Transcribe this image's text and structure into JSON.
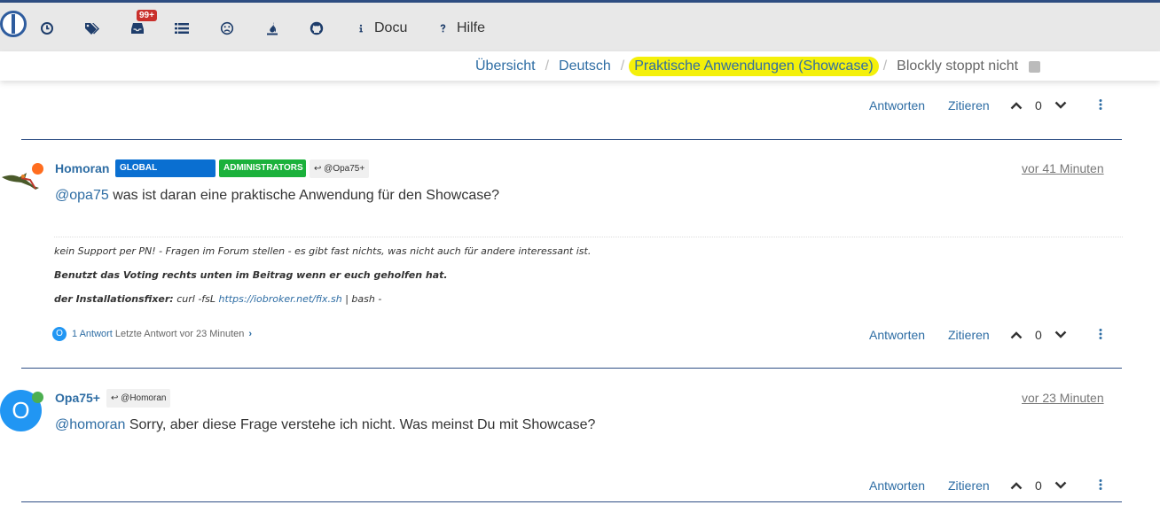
{
  "nav": {
    "unread_badge": "99+",
    "docu_label": "Docu",
    "help_label": "Hilfe"
  },
  "breadcrumb": {
    "items": [
      "Übersicht",
      "Deutsch",
      "Praktische Anwendungen (Showcase)",
      "Blockly stoppt nicht"
    ]
  },
  "actions": {
    "reply_label": "Antworten",
    "quote_label": "Zitieren"
  },
  "posts": [
    {
      "votes": "0"
    },
    {
      "username": "Homoran",
      "groups": [
        "GLOBAL MODERATOR",
        "ADMINISTRATORS"
      ],
      "group_colors": [
        "#0a6fd1",
        "#1bb13b"
      ],
      "reply_to": "@Opa75+",
      "timestamp": "vor 41 Minuten",
      "mention": "@opa75",
      "text": "was ist daran eine praktische Anwendung für den Showcase?",
      "signature": {
        "line1": "kein Support per PN! - Fragen im Forum stellen - es gibt fast nichts, was nicht auch für andere interessant ist.",
        "line2": "Benutzt das Voting rechts unten im Beitrag wenn er euch geholfen hat.",
        "line3_bold": "der Installationsfixer:",
        "line3_cmd": "curl -fsL",
        "line3_link": "https://iobroker.net/fix.sh",
        "line3_tail": "| bash -"
      },
      "replies": {
        "avatar_letter": "O",
        "count_label": "1 Antwort",
        "last_reply": "Letzte Antwort vor 23 Minuten"
      },
      "status_color": "#ff6d1f",
      "votes": "0"
    },
    {
      "username": "Opa75+",
      "avatar_letter": "O",
      "avatar_color": "#2196f3",
      "status_color": "#4caf50",
      "reply_to": "@Homoran",
      "timestamp": "vor 23 Minuten",
      "mention": "@homoran",
      "text": "Sorry, aber diese Frage verstehe ich nicht. Was meinst Du mit Showcase?",
      "votes": "0"
    }
  ],
  "colors": {
    "accent": "#2e6da4",
    "navbar_bg": "#e8e8e8",
    "highlight": "#f4f00a"
  }
}
